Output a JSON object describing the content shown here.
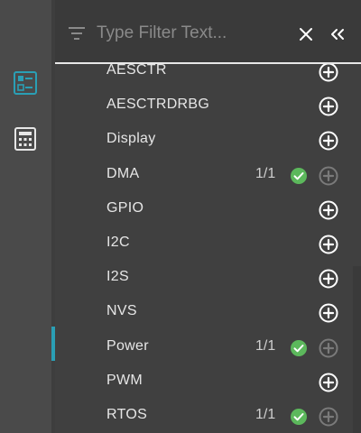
{
  "filter": {
    "placeholder": "Type Filter Text...",
    "value": ""
  },
  "activity_bar": {
    "items": [
      {
        "icon": "module-list-icon",
        "accent": "#2a9fb5"
      },
      {
        "icon": "calculator-icon",
        "accent": "#e0e0e0"
      }
    ]
  },
  "modules": [
    {
      "label": "AESCTR",
      "count": "",
      "added": false
    },
    {
      "label": "AESCTRDRBG",
      "count": "",
      "added": false
    },
    {
      "label": "Display",
      "count": "",
      "added": false
    },
    {
      "label": "DMA",
      "count": "1/1",
      "added": true
    },
    {
      "label": "GPIO",
      "count": "",
      "added": false
    },
    {
      "label": "I2C",
      "count": "",
      "added": false
    },
    {
      "label": "I2S",
      "count": "",
      "added": false
    },
    {
      "label": "NVS",
      "count": "",
      "added": false
    },
    {
      "label": "Power",
      "count": "1/1",
      "added": true,
      "active": true
    },
    {
      "label": "PWM",
      "count": "",
      "added": false
    },
    {
      "label": "RTOS",
      "count": "1/1",
      "added": true
    }
  ],
  "colors": {
    "check_green": "#5cb85c",
    "active_accent": "#2a9fb5",
    "add_enabled": "#ffffff",
    "add_disabled": "#7a7a7a"
  }
}
